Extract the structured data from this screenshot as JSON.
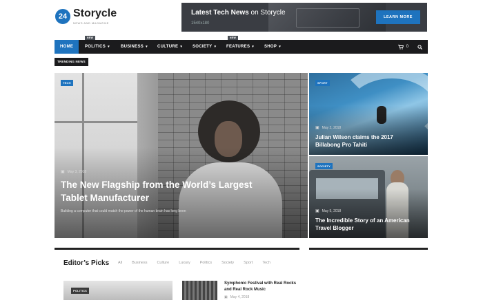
{
  "logo": {
    "badge": "24",
    "title": "Storycle",
    "tagline": "NEWS AND MAGAZINE"
  },
  "banner": {
    "headline_bold": "Latest Tech News",
    "headline_light": " on Storycle",
    "dims": "1540х180",
    "button": "LEARN MORE"
  },
  "nav": {
    "items": [
      {
        "label": "HOME",
        "active": true
      },
      {
        "label": "POLITICS",
        "chevron": "▾",
        "badge": "NEW"
      },
      {
        "label": "BUSINESS",
        "chevron": "▾"
      },
      {
        "label": "CULTURE",
        "chevron": "▾"
      },
      {
        "label": "SOCIETY",
        "chevron": "▾"
      },
      {
        "label": "FEATURES",
        "chevron": "▾",
        "badge": "NEW"
      },
      {
        "label": "SHOP",
        "chevron": "▾"
      }
    ],
    "cart_count": "0",
    "cart_icon": "cart-icon",
    "search_icon": "search-icon"
  },
  "trending_label": "TRENDING NEWS",
  "hero": {
    "category": "TECH",
    "date": "May 3, 2018",
    "title": "The New Flagship from the World’s Largest Tablet Manufacturer",
    "excerpt": "Building a computer that could match the power of the human brain has long been"
  },
  "side_cards": [
    {
      "category": "SPORT",
      "date": "May 2, 2018",
      "title": "Julian Wilson claims the 2017 Billabong Pro Tahiti"
    },
    {
      "category": "SOCIETY",
      "date": "May 5, 2018",
      "title": "The Incredible Story of an American Travel Blogger"
    }
  ],
  "picks": {
    "title": "Editor’s Picks",
    "tabs": [
      "All",
      "Business",
      "Culture",
      "Luxury",
      "Politics",
      "Society",
      "Sport",
      "Tech"
    ],
    "first_category": "POLITICS",
    "headline": "Symphonic Festival with Real Rocks and Real Rock Music",
    "date": "May 4, 2018"
  },
  "colors": {
    "accent": "#1e73be",
    "nav_bg": "#1b1b1d"
  }
}
